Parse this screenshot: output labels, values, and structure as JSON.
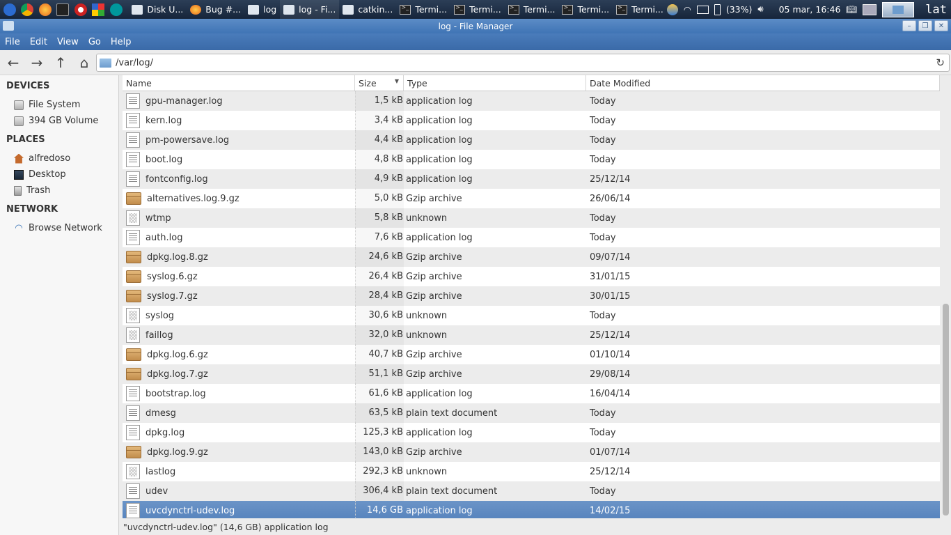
{
  "panel": {
    "tasks": [
      {
        "label": "Disk U...",
        "icon": "disk-icon"
      },
      {
        "label": "Bug #...",
        "icon": "firefox-icon"
      },
      {
        "label": "log",
        "icon": "folder-icon"
      },
      {
        "label": "log - Fi...",
        "icon": "folder-icon",
        "active": true
      },
      {
        "label": "catkin...",
        "icon": "folder-icon"
      },
      {
        "label": "Termi...",
        "icon": "terminal-icon"
      },
      {
        "label": "Termi...",
        "icon": "terminal-icon"
      },
      {
        "label": "Termi...",
        "icon": "terminal-icon"
      },
      {
        "label": "Termi...",
        "icon": "terminal-icon"
      },
      {
        "label": "Termi...",
        "icon": "terminal-icon"
      }
    ],
    "battery": "(33%)",
    "clock": "05 mar, 16:46",
    "keyboard": "lat"
  },
  "window": {
    "title": "log - File Manager"
  },
  "menu": [
    "File",
    "Edit",
    "View",
    "Go",
    "Help"
  ],
  "location": "/var/log/",
  "sidebar": {
    "devices_title": "DEVICES",
    "devices": [
      "File System",
      "394 GB Volume"
    ],
    "places_title": "PLACES",
    "places": [
      "alfredoso",
      "Desktop",
      "Trash"
    ],
    "network_title": "NETWORK",
    "network": [
      "Browse Network"
    ]
  },
  "columns": {
    "name": "Name",
    "size": "Size",
    "type": "Type",
    "date": "Date Modified"
  },
  "files": [
    {
      "name": "gpu-manager.log",
      "size": "1,5 kB",
      "type": "application log",
      "date": "Today",
      "icon": "doc"
    },
    {
      "name": "kern.log",
      "size": "3,4 kB",
      "type": "application log",
      "date": "Today",
      "icon": "doc"
    },
    {
      "name": "pm-powersave.log",
      "size": "4,4 kB",
      "type": "application log",
      "date": "Today",
      "icon": "doc"
    },
    {
      "name": "boot.log",
      "size": "4,8 kB",
      "type": "application log",
      "date": "Today",
      "icon": "doc"
    },
    {
      "name": "fontconfig.log",
      "size": "4,9 kB",
      "type": "application log",
      "date": "25/12/14",
      "icon": "doc"
    },
    {
      "name": "alternatives.log.9.gz",
      "size": "5,0 kB",
      "type": "Gzip archive",
      "date": "26/06/14",
      "icon": "gz"
    },
    {
      "name": "wtmp",
      "size": "5,8 kB",
      "type": "unknown",
      "date": "Today",
      "icon": "bin"
    },
    {
      "name": "auth.log",
      "size": "7,6 kB",
      "type": "application log",
      "date": "Today",
      "icon": "doc"
    },
    {
      "name": "dpkg.log.8.gz",
      "size": "24,6 kB",
      "type": "Gzip archive",
      "date": "09/07/14",
      "icon": "gz"
    },
    {
      "name": "syslog.6.gz",
      "size": "26,4 kB",
      "type": "Gzip archive",
      "date": "31/01/15",
      "icon": "gz"
    },
    {
      "name": "syslog.7.gz",
      "size": "28,4 kB",
      "type": "Gzip archive",
      "date": "30/01/15",
      "icon": "gz"
    },
    {
      "name": "syslog",
      "size": "30,6 kB",
      "type": "unknown",
      "date": "Today",
      "icon": "bin"
    },
    {
      "name": "faillog",
      "size": "32,0 kB",
      "type": "unknown",
      "date": "25/12/14",
      "icon": "bin"
    },
    {
      "name": "dpkg.log.6.gz",
      "size": "40,7 kB",
      "type": "Gzip archive",
      "date": "01/10/14",
      "icon": "gz"
    },
    {
      "name": "dpkg.log.7.gz",
      "size": "51,1 kB",
      "type": "Gzip archive",
      "date": "29/08/14",
      "icon": "gz"
    },
    {
      "name": "bootstrap.log",
      "size": "61,6 kB",
      "type": "application log",
      "date": "16/04/14",
      "icon": "doc"
    },
    {
      "name": "dmesg",
      "size": "63,5 kB",
      "type": "plain text document",
      "date": "Today",
      "icon": "doc"
    },
    {
      "name": "dpkg.log",
      "size": "125,3 kB",
      "type": "application log",
      "date": "Today",
      "icon": "doc"
    },
    {
      "name": "dpkg.log.9.gz",
      "size": "143,0 kB",
      "type": "Gzip archive",
      "date": "01/07/14",
      "icon": "gz"
    },
    {
      "name": "lastlog",
      "size": "292,3 kB",
      "type": "unknown",
      "date": "25/12/14",
      "icon": "bin"
    },
    {
      "name": "udev",
      "size": "306,4 kB",
      "type": "plain text document",
      "date": "Today",
      "icon": "doc"
    },
    {
      "name": "uvcdynctrl-udev.log",
      "size": "14,6 GB",
      "type": "application log",
      "date": "14/02/15",
      "icon": "doc",
      "selected": true
    }
  ],
  "status": "\"uvcdynctrl-udev.log\" (14,6 GB) application log"
}
